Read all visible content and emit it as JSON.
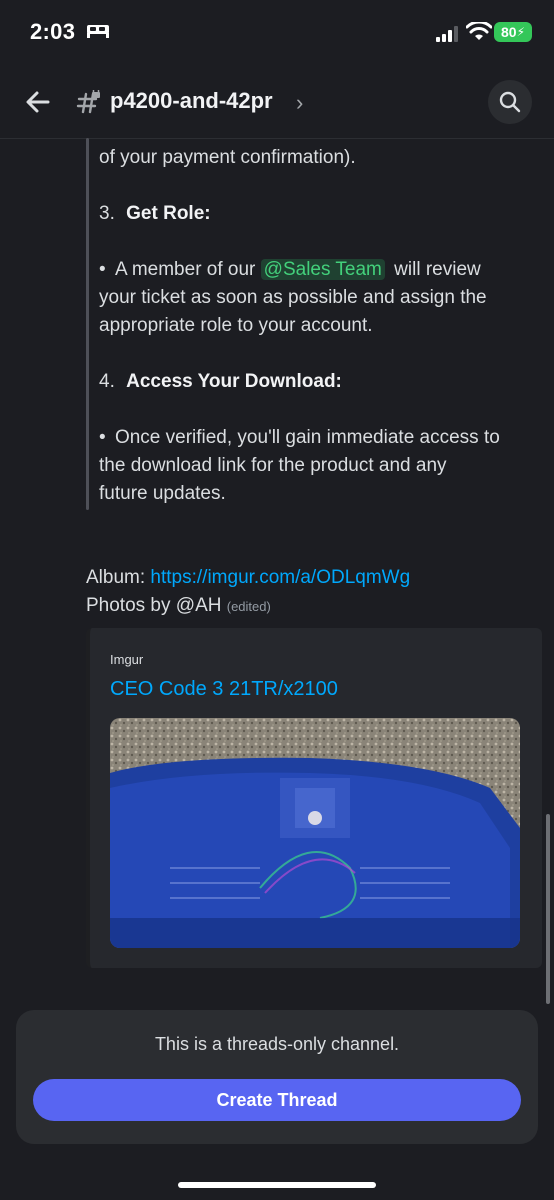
{
  "status_bar": {
    "time": "2:03",
    "battery": "80"
  },
  "header": {
    "channel_name": "p4200-and-42pr",
    "chevron": "›"
  },
  "message": {
    "partial_line": "of your payment confirmation).",
    "step3_num": "3.",
    "step3_title": "Get Role:",
    "bullet1_pre": "A member of our",
    "mention": "@Sales Team",
    "bullet1_post": "will review",
    "bullet1_l2": "your ticket as soon as possible and assign the",
    "bullet1_l3": "appropriate role to your account.",
    "step4_num": "4.",
    "step4_title": "Access Your Download:",
    "bullet2_l1": "Once verified, you'll gain immediate access to",
    "bullet2_l2": "the download link for the product and any",
    "bullet2_l3": "future updates.",
    "album_label": "Album:",
    "album_url": "https://imgur.com/a/ODLqmWg",
    "photos_by": "Photos by @AH",
    "edited": "(edited)"
  },
  "embed": {
    "provider": "Imgur",
    "title": "CEO Code 3 21TR/x2100"
  },
  "bottom": {
    "notice": "This is a threads-only channel.",
    "create_thread": "Create Thread"
  },
  "colors": {
    "accent": "#5865f2",
    "link": "#00a8fc",
    "mention": "#43d07b",
    "background": "#1c1d22"
  },
  "icons": [
    "bed-icon",
    "signal-icon",
    "wifi-icon",
    "battery-icon",
    "back-arrow-icon",
    "locked-hash-icon",
    "search-icon"
  ]
}
